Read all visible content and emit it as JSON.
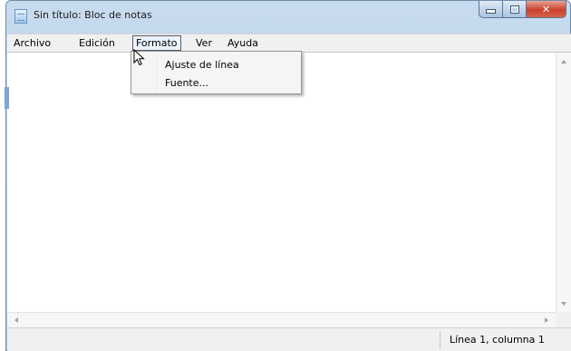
{
  "window": {
    "title": "Sin título: Bloc de notas"
  },
  "menubar": {
    "items": [
      {
        "label": "Archivo"
      },
      {
        "label": "Edición"
      },
      {
        "label": "Formato"
      },
      {
        "label": "Ver"
      },
      {
        "label": "Ayuda"
      }
    ],
    "active": "Formato"
  },
  "format_menu": {
    "items": [
      {
        "label": "Ajuste de línea"
      },
      {
        "label": "Fuente..."
      }
    ]
  },
  "statusbar": {
    "position": "Línea 1, columna 1"
  },
  "editor": {
    "content": ""
  },
  "icons": {
    "app": "notepad-icon",
    "minimize": "minimize-icon",
    "maximize": "maximize-icon",
    "close": "close-icon",
    "cursor": "mouse-pointer-icon"
  },
  "colors": {
    "title_gradient_top": "#c9dcef",
    "title_gradient_bottom": "#a9c4e2",
    "close_button": "#c9412c",
    "menu_highlight": "#eaf2fb"
  }
}
